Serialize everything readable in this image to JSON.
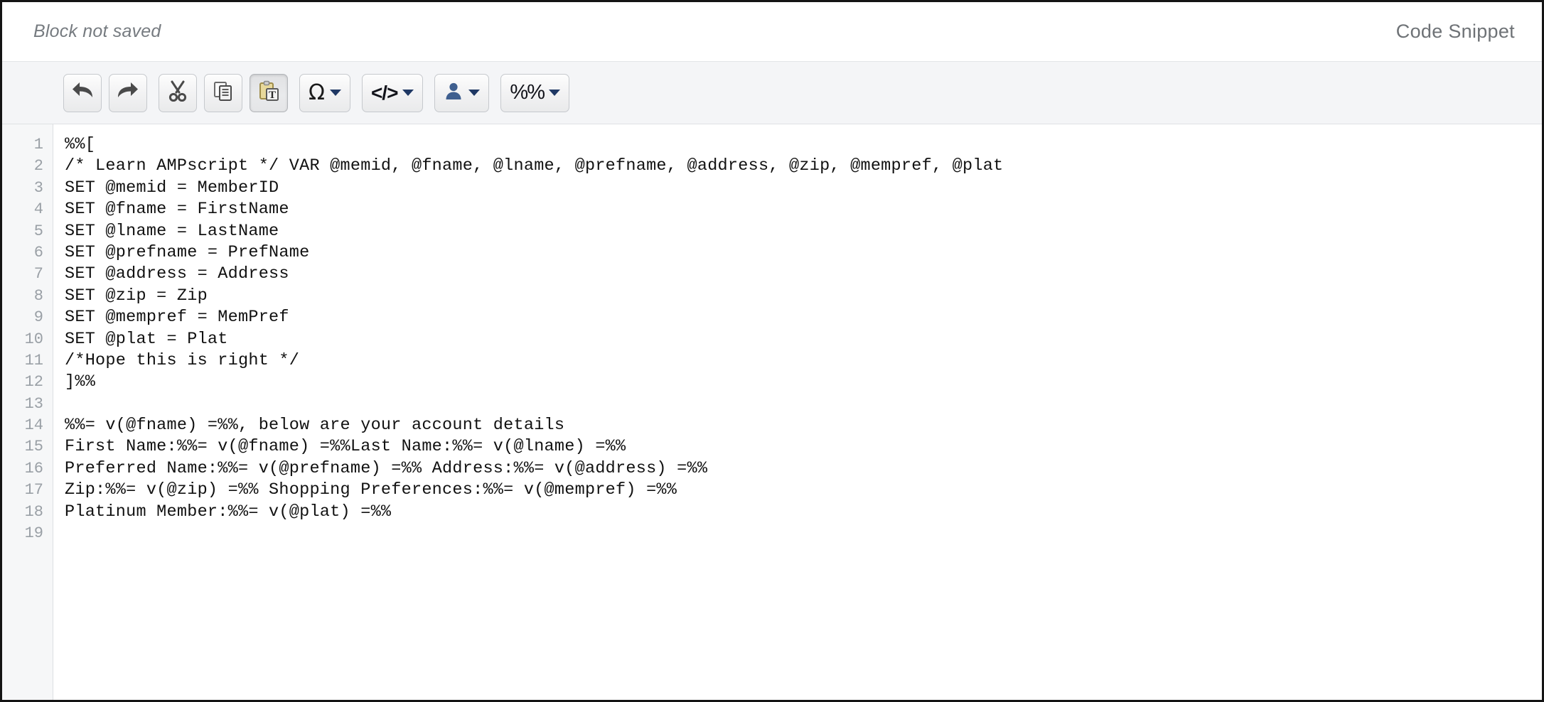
{
  "header": {
    "status_text": "Block not saved",
    "panel_title": "Code Snippet"
  },
  "toolbar": {
    "buttons": [
      {
        "name": "undo-button",
        "icon": "undo-arrow-icon",
        "label": "",
        "has_caret": false,
        "pressed": false
      },
      {
        "name": "redo-button",
        "icon": "redo-arrow-icon",
        "label": "",
        "has_caret": false,
        "pressed": false
      },
      {
        "name": "cut-button",
        "icon": "scissors-icon",
        "label": "",
        "has_caret": false,
        "pressed": false
      },
      {
        "name": "copy-button",
        "icon": "copy-documents-icon",
        "label": "",
        "has_caret": false,
        "pressed": false
      },
      {
        "name": "paste-as-text-button",
        "icon": "clipboard-text-icon",
        "label": "",
        "has_caret": false,
        "pressed": true
      },
      {
        "name": "special-character-button",
        "icon": "omega-icon",
        "label": "Ω",
        "has_caret": true,
        "pressed": false
      },
      {
        "name": "source-code-button",
        "icon": "code-brackets-icon",
        "label": "</>",
        "has_caret": true,
        "pressed": false
      },
      {
        "name": "personalization-button",
        "icon": "person-icon",
        "label": "",
        "has_caret": true,
        "pressed": false
      },
      {
        "name": "ampscript-button",
        "icon": "percent-percent-icon",
        "label": "%%",
        "has_caret": true,
        "pressed": false
      }
    ]
  },
  "editor": {
    "line_numbers": [
      1,
      2,
      3,
      4,
      5,
      6,
      7,
      8,
      9,
      10,
      11,
      12,
      13,
      14,
      15,
      16,
      17,
      18,
      19
    ],
    "lines": [
      "%%[",
      "/* Learn AMPscript */ VAR @memid, @fname, @lname, @prefname, @address, @zip, @mempref, @plat",
      "SET @memid = MemberID",
      "SET @fname = FirstName",
      "SET @lname = LastName",
      "SET @prefname = PrefName",
      "SET @address = Address",
      "SET @zip = Zip",
      "SET @mempref = MemPref",
      "SET @plat = Plat",
      "/*Hope this is right */",
      "]%%",
      "",
      "%%= v(@fname) =%%, below are your account details",
      "First Name:%%= v(@fname) =%%Last Name:%%= v(@lname) =%%",
      "Preferred Name:%%= v(@prefname) =%% Address:%%= v(@address) =%%",
      "Zip:%%= v(@zip) =%% Shopping Preferences:%%= v(@mempref) =%%",
      "Platinum Member:%%= v(@plat) =%%",
      ""
    ]
  },
  "colors": {
    "toolbar_bg": "#f4f5f7",
    "gutter_bg": "#f6f7f8",
    "line_number": "#9aa0a6",
    "code_text": "#111111",
    "status_text": "#767b80",
    "caret_blue": "#1f3864",
    "window_border": "#141414"
  }
}
